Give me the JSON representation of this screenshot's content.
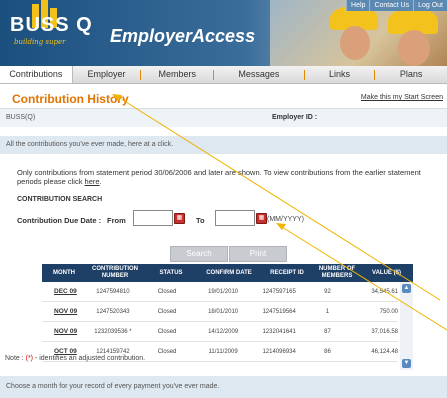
{
  "header": {
    "logo_text": "BUSS Q",
    "logo_tagline": "building super",
    "product_name": "EmployerAccess",
    "top_links": [
      "Help",
      "Contact Us",
      "Log Out"
    ]
  },
  "nav": {
    "items": [
      "Contributions",
      "Employer",
      "Members",
      "Messages",
      "Links",
      "Plans"
    ]
  },
  "page": {
    "title": "Contribution History",
    "start_screen_link": "Make this my Start Screen",
    "org_name": "BUSS(Q)",
    "employer_id_label": "Employer ID :",
    "intro": "All the contributions you've ever made, here at a click.",
    "notice_text": "Only contributions from statement period 30/06/2006 and later are shown. To view contributions from the earlier statement periods please click",
    "notice_link": "here",
    "search_heading": "CONTRIBUTION SEARCH",
    "due_label": "Contribution Due Date :",
    "from_label": "From",
    "to_label": "To",
    "from_value": "",
    "to_value": "",
    "date_format": "(MM/YYYY)",
    "search_button": "Search",
    "print_button": "Print",
    "adjusted_note_prefix": "Note : ",
    "adjusted_note_star": "(*)",
    "adjusted_note_suffix": " - identifies an adjusted contribution.",
    "footer_text": "Choose a month for your record of every payment you've ever made."
  },
  "table": {
    "columns": [
      "MONTH",
      "CONTRIBUTION NUMBER",
      "STATUS",
      "CONFIRM DATE",
      "RECEIPT ID",
      "NUMBER OF MEMBERS",
      "VALUE ($)"
    ],
    "rows": [
      [
        "DEC 09",
        "1247594810",
        "Closed",
        "19/01/2010",
        "1247597165",
        "92",
        "34,545.61"
      ],
      [
        "NOV 09",
        "1247520343",
        "Closed",
        "18/01/2010",
        "1247519564",
        "1",
        "750.00"
      ],
      [
        "NOV 09",
        "1232039536 *",
        "Closed",
        "14/12/2009",
        "1232041641",
        "87",
        "37,016.58"
      ],
      [
        "OCT 09",
        "1214159742",
        "Closed",
        "11/11/2009",
        "1214096934",
        "86",
        "46,124.48"
      ]
    ]
  },
  "colors": {
    "title_orange": "#e07400",
    "header_blue": "#1b4f7e",
    "table_header": "#1e3f66",
    "info_bar": "#dde8f1",
    "annotation_arrow": "#f0b400"
  }
}
